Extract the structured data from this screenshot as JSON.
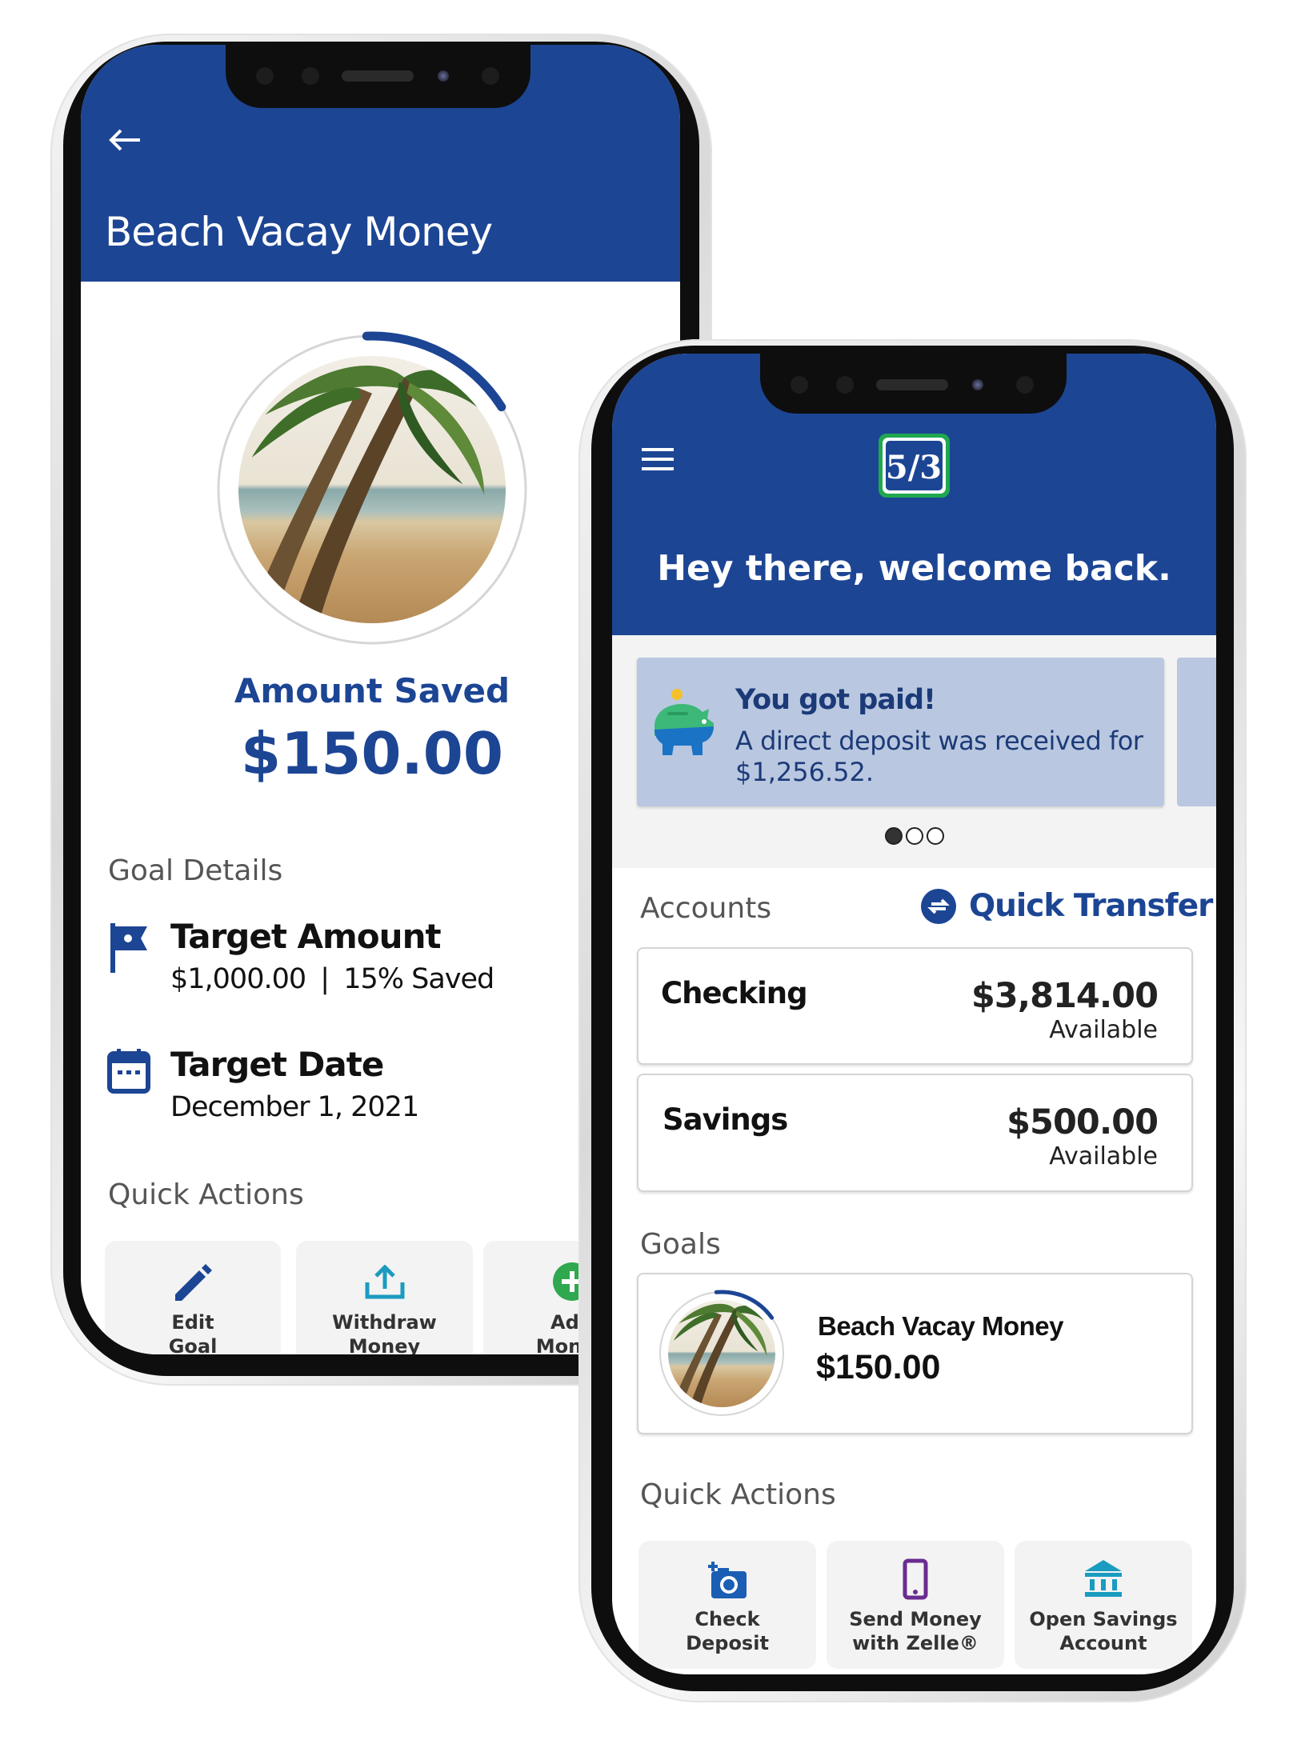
{
  "goal_screen": {
    "back_icon": "arrow-left-icon",
    "title": "Beach Vacay Money",
    "progress": 0.15,
    "amount_saved_label": "Amount Saved",
    "amount_saved": "$150.00",
    "goal_details_heading": "Goal Details",
    "target_amount": {
      "icon": "flag-icon",
      "title": "Target Amount",
      "amount": "$1,000.00",
      "separator": "|",
      "percent": "15% Saved"
    },
    "target_date": {
      "icon": "calendar-icon",
      "title": "Target Date",
      "value": "December 1, 2021"
    },
    "quick_actions_heading": "Quick Actions",
    "actions": [
      {
        "icon": "pencil-icon",
        "line1": "Edit",
        "line2": "Goal"
      },
      {
        "icon": "upload-icon",
        "line1": "Withdraw",
        "line2": "Money"
      },
      {
        "icon": "plus-circle-icon",
        "line1": "Add",
        "line2": "Money"
      }
    ]
  },
  "home_screen": {
    "menu_icon": "hamburger-menu-icon",
    "logo": "5/3",
    "welcome": "Hey there, welcome back.",
    "notification": {
      "icon": "piggy-bank-icon",
      "title": "You got paid!",
      "line1": "A direct deposit was received for",
      "line2": "$1,256.52."
    },
    "carousel": {
      "count": 3,
      "active": 0
    },
    "accounts_heading": "Accounts",
    "quick_transfer": {
      "icon": "transfer-arrows-icon",
      "label": "Quick Transfer"
    },
    "accounts": [
      {
        "name": "Checking",
        "balance": "$3,814.00",
        "status": "Available"
      },
      {
        "name": "Savings",
        "balance": "$500.00",
        "status": "Available"
      }
    ],
    "goals_heading": "Goals",
    "goal": {
      "name": "Beach Vacay Money",
      "amount": "$150.00",
      "progress": 0.15
    },
    "quick_actions_heading": "Quick Actions",
    "actions": [
      {
        "icon": "camera-plus-icon",
        "line1": "Check",
        "line2": "Deposit"
      },
      {
        "icon": "smartphone-icon",
        "line1": "Send Money",
        "line2": "with Zelle®"
      },
      {
        "icon": "bank-icon",
        "line1": "Open Savings",
        "line2": "Account"
      }
    ]
  },
  "colors": {
    "brand_blue": "#1c4594",
    "card_blue": "#b9c8e0",
    "logo_green": "#1fa84f",
    "zelle_purple": "#6b2c91",
    "teal": "#1a9bc0",
    "add_green": "#2fa84f"
  }
}
